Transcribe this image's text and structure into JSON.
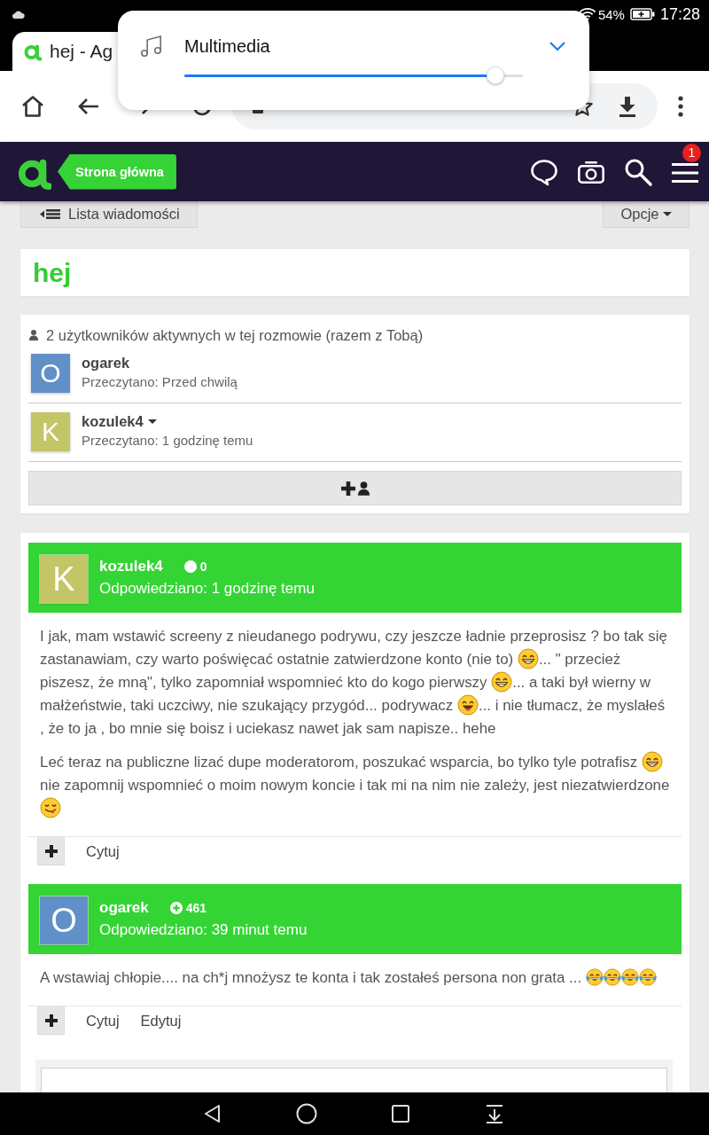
{
  "status_bar": {
    "battery": "54%",
    "time": "17:28"
  },
  "browser": {
    "tab_title": "hej - Ag"
  },
  "volume_popup": {
    "label": "Multimedia",
    "level": 0.92
  },
  "site_header": {
    "home_link": "Strona główna",
    "menu_badge": "1"
  },
  "message_toolbar": {
    "back_link": "Lista wiadomości",
    "options": "Opcje"
  },
  "conversation_title": "hej",
  "participants": {
    "summary": "2 użytkowników aktywnych w tej rozmowie (razem z Tobą)",
    "users": [
      {
        "initial": "O",
        "name": "ogarek",
        "read": "Przeczytano: Przed chwilą",
        "color": "#6190c8",
        "has_menu": false
      },
      {
        "initial": "K",
        "name": "kozulek4",
        "read": "Przeczytano: 1 godzinę temu",
        "color": "#c4c566",
        "has_menu": true
      }
    ]
  },
  "posts": [
    {
      "author": {
        "initial": "K",
        "name": "kozulek4",
        "color": "#c4c566"
      },
      "reputation": {
        "kind": "neutral",
        "value": "0"
      },
      "time": "Odpowiedziano: 1 godzinę temu",
      "paragraphs": [
        [
          {
            "kind": "text",
            "text": "I jak, mam wstawić screeny z nieudanego podrywu, czy jeszcze ładnie przeprosisz ? bo tak się zastanawiam, czy warto poświęcać ostatnie zatwierdzone konto (nie to) "
          },
          {
            "kind": "grin"
          },
          {
            "kind": "text",
            "text": "... \" przecież piszesz, że mną\", tylko zapomniał wspomnieć kto do kogo pierwszy "
          },
          {
            "kind": "grin"
          },
          {
            "kind": "text",
            "text": "... a taki był wierny w małżeństwie, taki uczciwy, nie szukający przygód... podrywacz "
          },
          {
            "kind": "laugh"
          },
          {
            "kind": "text",
            "text": "... i nie tłumacz, że myslałeś , że to ja , bo mnie się boisz i uciekasz nawet jak sam napisze.. hehe"
          }
        ],
        [
          {
            "kind": "text",
            "text": "Leć teraz na publiczne lizać dupe moderatorom, poszukać wsparcia, bo tylko tyle potrafisz "
          },
          {
            "kind": "grin"
          },
          {
            "kind": "text",
            "text": " nie zapomnij wspomnieć o moim nowym koncie i tak mi na nim nie zależy, jest niezatwierdzone "
          },
          {
            "kind": "tongue"
          }
        ]
      ],
      "actions": [
        "Cytuj"
      ]
    },
    {
      "author": {
        "initial": "O",
        "name": "ogarek",
        "color": "#6190c8"
      },
      "reputation": {
        "kind": "positive",
        "value": "461"
      },
      "time": "Odpowiedziano: 39 minut temu",
      "paragraphs": [
        [
          {
            "kind": "text",
            "text": "A wstawiaj chłopie.... na ch*j mnożysz te konta i tak zostałeś persona non grata ... "
          },
          {
            "kind": "joy"
          },
          {
            "kind": "joy"
          },
          {
            "kind": "joy"
          },
          {
            "kind": "joy"
          }
        ]
      ],
      "actions": [
        "Cytuj",
        "Edytuj"
      ]
    }
  ]
}
